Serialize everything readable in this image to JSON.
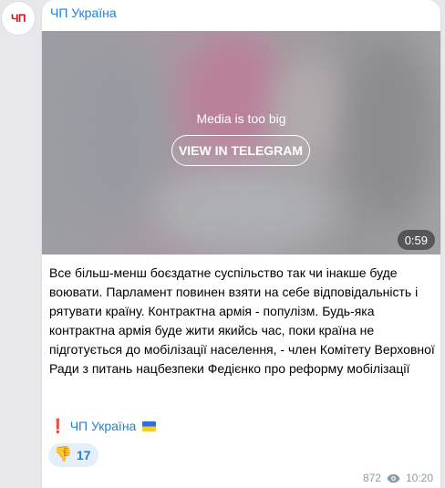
{
  "channel": {
    "name": "ЧП Україна",
    "avatar_text": "ЧП"
  },
  "media": {
    "notice": "Media is too big",
    "button_label": "VIEW IN TELEGRAM",
    "duration": "0:59"
  },
  "post": {
    "text": "Все більш-менш боєздатне суспільство так чи інакше буде воювати. Парламент повинен взяти на себе відповідальність і рятувати країну. Контрактна армія - популізм. Будь-яка контрактна армія буде жити якийсь час, поки країна не підготується до мобілізації населення, - член Комітету Верховної Ради з питань нацбезпеки Федієнко про реформу мобілізації",
    "signature_text": "ЧП Україна"
  },
  "reaction": {
    "icon": "thumbs-down-icon",
    "glyph": "👎",
    "count": "17"
  },
  "meta": {
    "views": "872",
    "time": "10:20"
  },
  "colors": {
    "accent": "#2481cc",
    "brand_red": "#d0161b",
    "background": "#e8e8ec"
  }
}
